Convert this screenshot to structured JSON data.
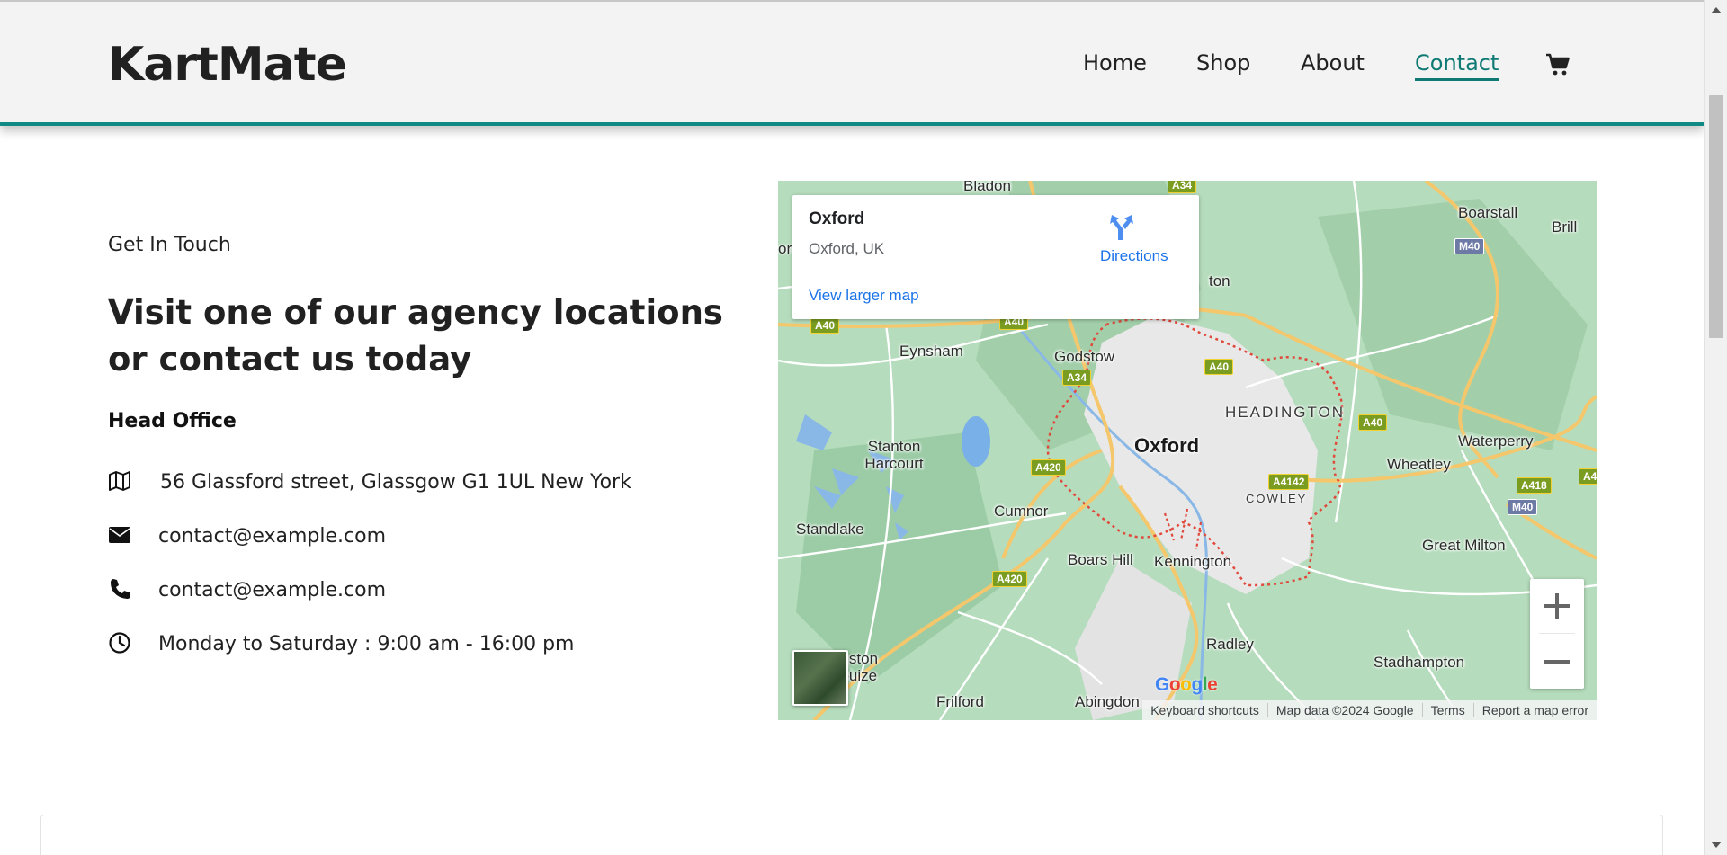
{
  "brand": {
    "logo": "KartMate"
  },
  "nav": {
    "items": [
      {
        "label": "Home",
        "active": false
      },
      {
        "label": "Shop",
        "active": false
      },
      {
        "label": "About",
        "active": false
      },
      {
        "label": "Contact",
        "active": true
      }
    ],
    "cart_icon": "shopping-cart-icon",
    "accent_color": "#0f7a74"
  },
  "contact": {
    "eyebrow": "Get In Touch",
    "headline": "Visit one of our agency locations or contact us today",
    "office_title": "Head Office",
    "rows": [
      {
        "icon": "map-icon",
        "text": "56 Glassford street, Glassgow G1 1UL New York"
      },
      {
        "icon": "envelope-icon",
        "text": "contact@example.com"
      },
      {
        "icon": "phone-icon",
        "text": "contact@example.com"
      },
      {
        "icon": "clock-icon",
        "text": "Monday to Saturday : 9:00 am - 16:00 pm"
      }
    ]
  },
  "map": {
    "place_name": "Oxford",
    "place_address": "Oxford, UK",
    "directions_label": "Directions",
    "larger_map_link": "View larger map",
    "google_logo": "Google",
    "attribution": [
      "Keyboard shortcuts",
      "Map data ©2024 Google",
      "Terms",
      "Report a map error"
    ],
    "places": {
      "oxford": "Oxford",
      "headington": "HEADINGTON",
      "cowley": "COWLEY",
      "bladon": "Bladon",
      "boarstall": "Boarstall",
      "brill": "Brill",
      "eynsham": "Eynsham",
      "godstow": "Godstow",
      "stanton_harcourt": "Stanton Harcourt",
      "wheatley": "Wheatley",
      "waterperry": "Waterperry",
      "cumnor": "Cumnor",
      "standlake": "Standlake",
      "boars_hill": "Boars Hill",
      "kennington": "Kennington",
      "great_milton": "Great Milton",
      "radley": "Radley",
      "stadhampton": "Stadhampton",
      "frilford": "Frilford",
      "abingdon": "Abingdon",
      "kingston_bagpuize_1": "ngston",
      "kingston_bagpuize_2": "gpuize",
      "marston_partial": "ton",
      "wootton_partial": "ort"
    },
    "roads": {
      "a34_top": "A34",
      "a34": "A34",
      "a40_left": "A40",
      "a40_mid": "A40",
      "a40_right": "A40",
      "a40_east": "A40",
      "a420_1": "A420",
      "a420_2": "A420",
      "a4142": "A4142",
      "a418": "A418",
      "m40_top": "M40",
      "m40_bottom": "M40",
      "a4_edge": "A4"
    }
  }
}
